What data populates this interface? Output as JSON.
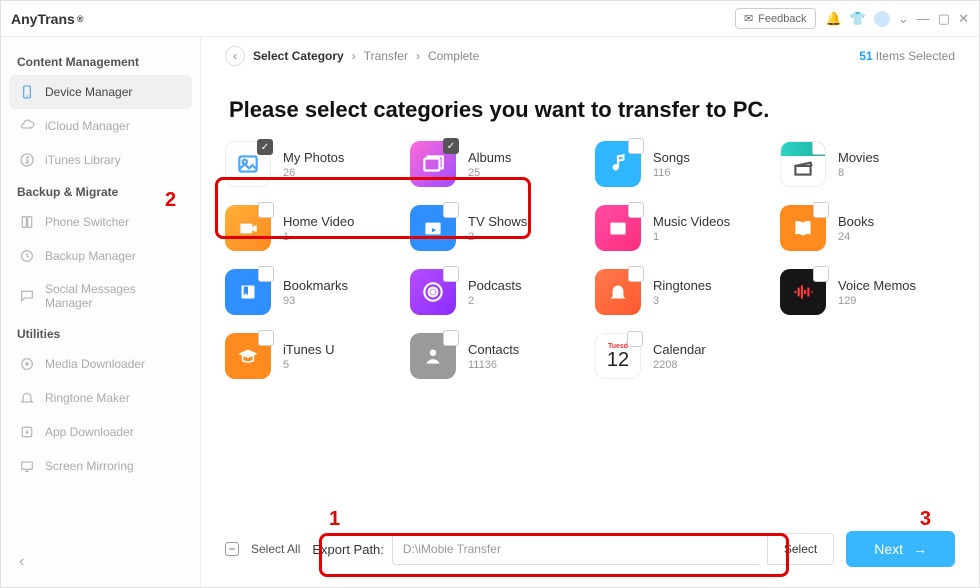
{
  "app": {
    "brand": "AnyTrans",
    "reg": "®",
    "feedback": "Feedback"
  },
  "sidebar": {
    "s1": "Content Management",
    "s2": "Backup & Migrate",
    "s3": "Utilities",
    "items": [
      "Device Manager",
      "iCloud Manager",
      "iTunes Library",
      "Phone Switcher",
      "Backup Manager",
      "Social Messages Manager",
      "Media Downloader",
      "Ringtone Maker",
      "App Downloader",
      "Screen Mirroring"
    ]
  },
  "crumb": {
    "a": "Select Category",
    "b": "Transfer",
    "c": "Complete"
  },
  "selected": {
    "n": "51",
    "t": "Items Selected"
  },
  "heading": "Please select categories you want to transfer to PC.",
  "cats": [
    {
      "n": "My Photos",
      "c": "26"
    },
    {
      "n": "Albums",
      "c": "25"
    },
    {
      "n": "Songs",
      "c": "116"
    },
    {
      "n": "Movies",
      "c": "8"
    },
    {
      "n": "Home Video",
      "c": "1"
    },
    {
      "n": "TV Shows",
      "c": "2"
    },
    {
      "n": "Music Videos",
      "c": "1"
    },
    {
      "n": "Books",
      "c": "24"
    },
    {
      "n": "Bookmarks",
      "c": "93"
    },
    {
      "n": "Podcasts",
      "c": "2"
    },
    {
      "n": "Ringtones",
      "c": "3"
    },
    {
      "n": "Voice Memos",
      "c": "129"
    },
    {
      "n": "iTunes U",
      "c": "5"
    },
    {
      "n": "Contacts",
      "c": "11136"
    },
    {
      "n": "Calendar",
      "c": "2208"
    }
  ],
  "cal": {
    "d": "Tuesd",
    "n": "12"
  },
  "footer": {
    "sa": "Select All",
    "ep": "Export Path:",
    "path": "D:\\iMobie Transfer",
    "sel": "Select",
    "next": "Next"
  },
  "hints": {
    "h1": "1",
    "h2": "2",
    "h3": "3"
  }
}
